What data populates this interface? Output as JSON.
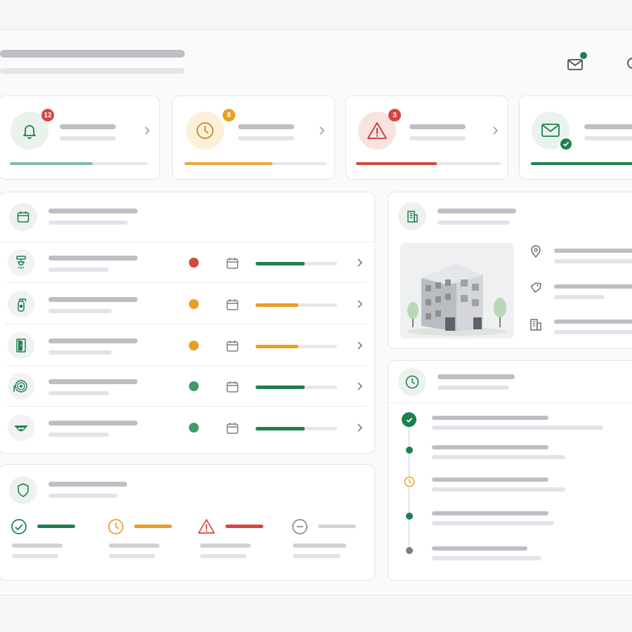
{
  "header": {
    "mail_icon": "mail-icon",
    "search_icon": "search-icon",
    "notification_color": "#1e7f4f"
  },
  "summary_cards": [
    {
      "icon": "bell-icon",
      "badge": "12",
      "badge_color": "#d9453d",
      "progress": 0.6,
      "color": "#7fbf9f",
      "icon_color": "#1e7f4f",
      "bg": "#e9f2ec"
    },
    {
      "icon": "clock-icon",
      "badge": "8",
      "badge_color": "#e8a020",
      "progress": 0.62,
      "color": "#e8a838",
      "icon_color": "#c98a1a",
      "bg": "#fbf0d9"
    },
    {
      "icon": "warning-icon",
      "badge": "3",
      "badge_color": "#d9453d",
      "progress": 0.5,
      "color": "#d2473f",
      "icon_color": "#c53a32",
      "bg": "#f9e3e1"
    },
    {
      "icon": "mail-icon",
      "badge": "",
      "badge_color": "#1e7f4f",
      "progress": 1.0,
      "color": "#1e7f4f",
      "icon_color": "#1e7f4f",
      "bg": "#e9f2ec"
    }
  ],
  "equipment": {
    "header_icon": "calendar-icon",
    "rows": [
      {
        "icon": "sprinkler-icon",
        "status_color": "#d2473f",
        "progress": 0.6,
        "bar_color": "#1e7f4f"
      },
      {
        "icon": "fire-extinguisher-icon",
        "status_color": "#e8a020",
        "progress": 0.53,
        "bar_color": "#e8a020"
      },
      {
        "icon": "exit-door-icon",
        "status_color": "#e8a020",
        "progress": 0.53,
        "bar_color": "#e8a020"
      },
      {
        "icon": "fire-hose-icon",
        "status_color": "#3f9a6d",
        "progress": 0.6,
        "bar_color": "#1e7f4f"
      },
      {
        "icon": "smoke-detector-icon",
        "status_color": "#3f9a6d",
        "progress": 0.6,
        "bar_color": "#1e7f4f"
      }
    ]
  },
  "compliance": {
    "header_icon": "shield-icon",
    "items": [
      {
        "icon": "check-circle-icon",
        "color": "#1e7f4f"
      },
      {
        "icon": "clock-icon",
        "color": "#e8a020"
      },
      {
        "icon": "warning-icon",
        "color": "#d2473f"
      },
      {
        "icon": "minus-circle-icon",
        "color": "#8a8d93"
      }
    ]
  },
  "building": {
    "header_icon": "building-icon",
    "details_icons": [
      "location-pin-icon",
      "tag-icon",
      "building-icon"
    ]
  },
  "timeline": {
    "header_icon": "clock-icon",
    "events": [
      {
        "type": "check",
        "color": "#1e7f4f"
      },
      {
        "type": "dot",
        "color": "#1e7f4f"
      },
      {
        "type": "clock",
        "color": "#e8a020"
      },
      {
        "type": "dot",
        "color": "#1e7f4f"
      },
      {
        "type": "dot",
        "color": "#7b7e85"
      }
    ]
  }
}
